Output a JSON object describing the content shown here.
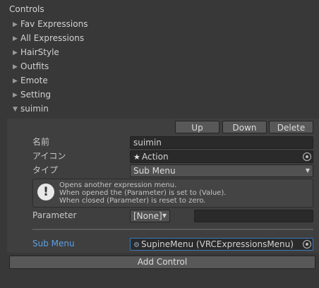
{
  "header": {
    "title": "Controls"
  },
  "foldouts": [
    {
      "label": "Fav Expressions",
      "expanded": false
    },
    {
      "label": "All Expressions",
      "expanded": false
    },
    {
      "label": "HairStyle",
      "expanded": false
    },
    {
      "label": "Outfits",
      "expanded": false
    },
    {
      "label": "Emote",
      "expanded": false
    },
    {
      "label": "Setting",
      "expanded": false
    }
  ],
  "expanded_item": {
    "label": "suimin"
  },
  "buttons": {
    "up": "Up",
    "down": "Down",
    "delete": "Delete",
    "add_control": "Add Control"
  },
  "fields": {
    "name_label": "名前",
    "name_value": "suimin",
    "icon_label": "アイコン",
    "icon_value": "Action",
    "type_label": "タイプ",
    "type_value": "Sub Menu",
    "parameter_label": "Parameter",
    "parameter_value": "[None]",
    "parameter_extra": "",
    "submenu_label": "Sub Menu",
    "submenu_value": "SupineMenu (VRCExpressionsMenu)"
  },
  "help": {
    "line1": "Opens another expression menu.",
    "line2": "When opened the (Parameter) is set to (Value).",
    "line3": "When closed (Parameter) is reset to zero."
  },
  "colors": {
    "background": "#383838",
    "panel": "#3f3f3f",
    "accent_label": "#5aa0e6",
    "focus_border": "#3a79bb"
  },
  "icons": {
    "foldout_collapsed": "triangle-right-icon",
    "foldout_expanded": "triangle-down-icon",
    "help": "exclamation-circle-icon",
    "object_picker": "object-picker-icon",
    "action": "action-figure-icon",
    "submenu_asset": "expressions-menu-asset-icon"
  }
}
